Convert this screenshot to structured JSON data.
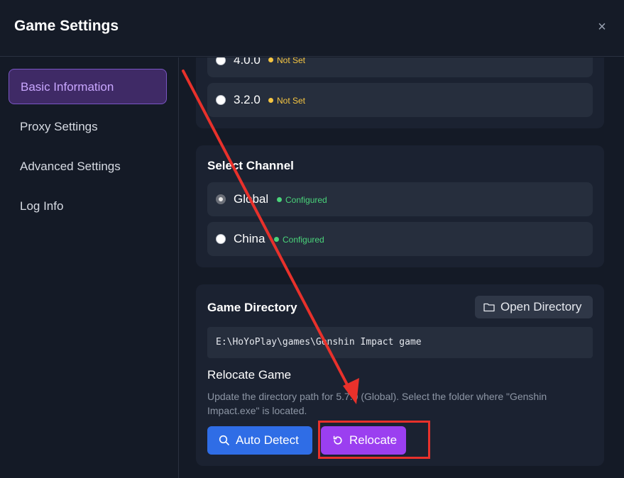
{
  "header": {
    "title": "Game Settings",
    "close_icon": "×"
  },
  "sidebar": {
    "items": [
      {
        "label": "Basic Information",
        "active": true
      },
      {
        "label": "Proxy Settings",
        "active": false
      },
      {
        "label": "Advanced Settings",
        "active": false
      },
      {
        "label": "Log Info",
        "active": false
      }
    ]
  },
  "versions": {
    "options": [
      {
        "label": "4.0.0",
        "status": "Not Set",
        "checked": false
      },
      {
        "label": "3.2.0",
        "status": "Not Set",
        "checked": false
      }
    ]
  },
  "channel": {
    "title": "Select Channel",
    "options": [
      {
        "label": "Global",
        "status": "Configured",
        "checked": true
      },
      {
        "label": "China",
        "status": "Configured",
        "checked": false
      }
    ]
  },
  "directory": {
    "title": "Game Directory",
    "open_button": "Open Directory",
    "path": "E:\\HoYoPlay\\games\\Genshin Impact game",
    "relocate_title": "Relocate Game",
    "relocate_desc": "Update the directory path for 5.7.0 (Global). Select the folder where \"Genshin Impact.exe\" is located.",
    "auto_detect_button": "Auto Detect",
    "relocate_button": "Relocate"
  },
  "colors": {
    "accent_purple": "#9b3ff0",
    "accent_blue": "#2f6de6",
    "warn": "#f5c542",
    "ok": "#4ad47a",
    "annotation_red": "#e8312b"
  }
}
